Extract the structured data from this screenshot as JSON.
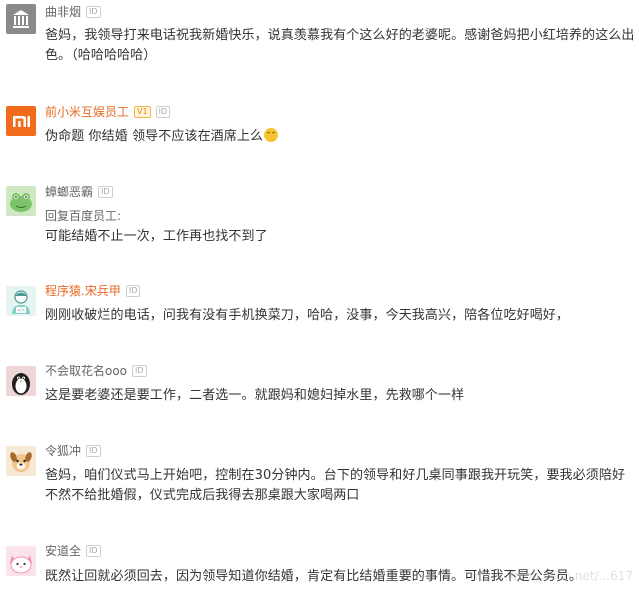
{
  "badge_label": "ID",
  "vip_label": "V1",
  "comments": [
    {
      "username": "曲非烟",
      "text": "爸妈，我领导打来电话祝我新婚快乐，说真羡慕我有个这么好的老婆呢。感谢爸妈把小红培养的这么出色。（哈哈哈哈哈）"
    },
    {
      "username": "前小米互娱员工",
      "text": "伪命题 你结婚 领导不应该在酒席上么"
    },
    {
      "username": "蟑螂恶霸",
      "reply_to": "回复百度员工:",
      "text": "可能结婚不止一次，工作再也找不到了"
    },
    {
      "username": "程序猿.宋兵甲",
      "text": "刚刚收破烂的电话，问我有没有手机换菜刀，哈哈，没事，今天我高兴，陪各位吃好喝好，"
    },
    {
      "username": "不会取花名ooo",
      "text": "这是要老婆还是要工作，二者选一。就跟妈和媳妇掉水里，先救哪个一样"
    },
    {
      "username": "令狐冲",
      "text": "爸妈，咱们仪式马上开始吧，控制在30分钟内。台下的领导和好几桌同事跟我开玩笑，要我必须陪好不然不给批婚假，仪式完成后我得去那桌跟大家喝两口"
    },
    {
      "username": "安道全",
      "text": "既然让回就必须回去，因为领导知道你结婚，肯定有比结婚重要的事情。可惜我不是公务员。"
    }
  ],
  "watermark": "https://blog.csdn.net/...617"
}
